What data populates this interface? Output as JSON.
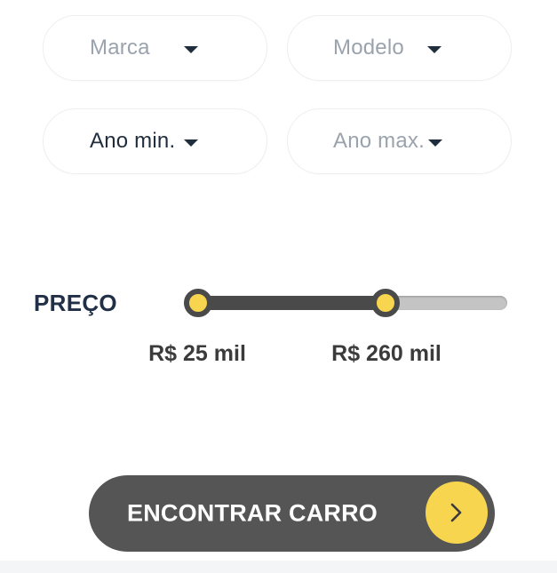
{
  "filters": {
    "marca": {
      "label": "Marca"
    },
    "modelo": {
      "label": "Modelo"
    },
    "ano_min": {
      "label": "Ano min."
    },
    "ano_max": {
      "label": "Ano max."
    }
  },
  "price": {
    "label": "PREÇO",
    "min_label": "R$ 25 mil",
    "max_label": "R$ 260 mil",
    "range_fraction": {
      "min": 0.0,
      "max": 0.59
    }
  },
  "cta": {
    "label": "ENCONTRAR CARRO",
    "icon": "chevron-right-icon"
  },
  "colors": {
    "accent": "#f7d54e",
    "dark": "#4a4a4a",
    "text_dark": "#1f2d3d",
    "text_muted": "#9aa3ad"
  }
}
